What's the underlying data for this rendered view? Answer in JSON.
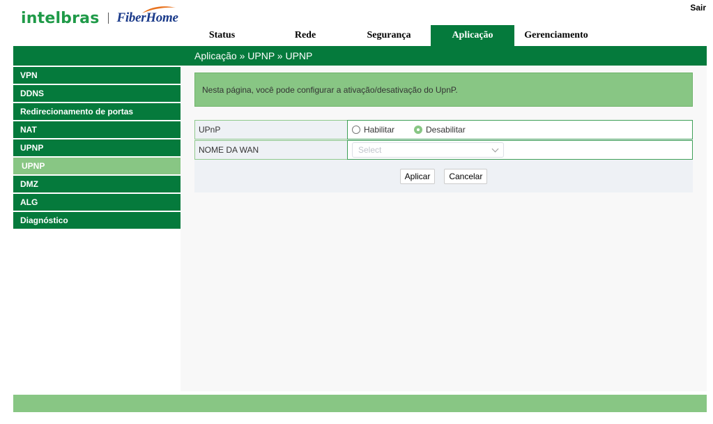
{
  "header": {
    "logo_left": "intelbras",
    "logo_right": "FiberHome",
    "logout_label": "Sair"
  },
  "topnav": {
    "tabs": [
      {
        "label": "Status"
      },
      {
        "label": "Rede"
      },
      {
        "label": "Segurança"
      },
      {
        "label": "Aplicação",
        "active": true
      },
      {
        "label": "Gerenciamento"
      }
    ]
  },
  "breadcrumb": "Aplicação » UPNP » UPNP",
  "sidebar": {
    "items": [
      {
        "label": "VPN"
      },
      {
        "label": "DDNS"
      },
      {
        "label": "Redirecionamento de portas"
      },
      {
        "label": "NAT"
      },
      {
        "label": "UPNP"
      },
      {
        "label": "UPNP",
        "sub": true,
        "active": true
      },
      {
        "label": "DMZ"
      },
      {
        "label": "ALG"
      },
      {
        "label": "Diagnóstico"
      }
    ]
  },
  "info": "Nesta página, você pode configurar a ativação/desativação do UpnP.",
  "form": {
    "upnp_label": "UPnP",
    "enable_label": "Habilitar",
    "disable_label": "Desabilitar",
    "selected": "Desabilitar",
    "wan_label": "NOME DA WAN",
    "wan_placeholder": "Select"
  },
  "buttons": {
    "apply": "Aplicar",
    "cancel": "Cancelar"
  },
  "colors": {
    "primary_green": "#057a3c",
    "light_green": "#88c684",
    "logo_green": "#1f9a48",
    "logo_blue": "#1a3a8a",
    "swoosh_orange": "#e8731f"
  }
}
